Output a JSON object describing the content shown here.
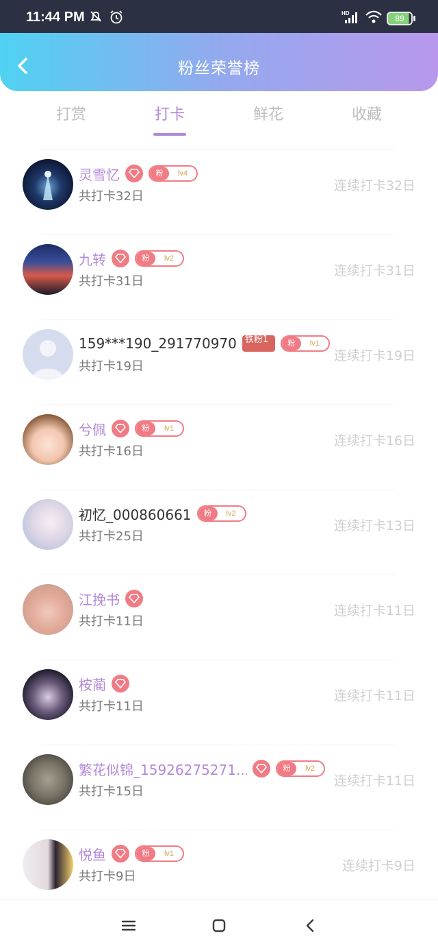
{
  "status_bar": {
    "time": "11:44 PM",
    "battery": "89",
    "icons": [
      "mute-icon",
      "alarm-icon",
      "hd-signal-icon",
      "wifi-icon",
      "battery-icon"
    ]
  },
  "header": {
    "title": "粉丝荣誉榜",
    "back_icon": "chevron-left-icon"
  },
  "tabs": [
    {
      "label": "打赏",
      "active": false
    },
    {
      "label": "打卡",
      "active": true
    },
    {
      "label": "鲜花",
      "active": false
    },
    {
      "label": "收藏",
      "active": false
    }
  ],
  "colors": {
    "accent": "#b388d9",
    "badge": "#f17b84",
    "muted": "#cfcfcf"
  },
  "rows": [
    {
      "name": "灵雪忆",
      "total": "共打卡32日",
      "streak": "连续打卡32日",
      "level": "lv4",
      "fan": "粉"
    },
    {
      "name": "九转",
      "total": "共打卡31日",
      "streak": "连续打卡31日",
      "level": "lv2",
      "fan": "粉"
    },
    {
      "name": "159***190_291770970",
      "total": "共打卡19日",
      "streak": "连续打卡19日",
      "level": "lv1",
      "fan": "粉",
      "iron": "铁粉1"
    },
    {
      "name": "兮佩",
      "total": "共打卡16日",
      "streak": "连续打卡16日",
      "level": "lv1",
      "fan": "粉"
    },
    {
      "name": "初忆_000860661",
      "total": "共打卡25日",
      "streak": "连续打卡13日",
      "level": "lv2",
      "fan": "粉"
    },
    {
      "name": "江挽书",
      "total": "共打卡11日",
      "streak": "连续打卡11日"
    },
    {
      "name": "桉蔺",
      "total": "共打卡11日",
      "streak": "连续打卡11日"
    },
    {
      "name": "繁花似锦_15926275271...",
      "total": "共打卡15日",
      "streak": "连续打卡11日",
      "level": "lv2",
      "fan": "粉"
    },
    {
      "name": "悦鱼",
      "total": "共打卡9日",
      "streak": "连续打卡9日",
      "level": "lv1",
      "fan": "粉"
    }
  ],
  "nav": {
    "menu_icon": "menu-icon",
    "home_icon": "home-square-icon",
    "back_icon": "back-triangle-icon"
  }
}
